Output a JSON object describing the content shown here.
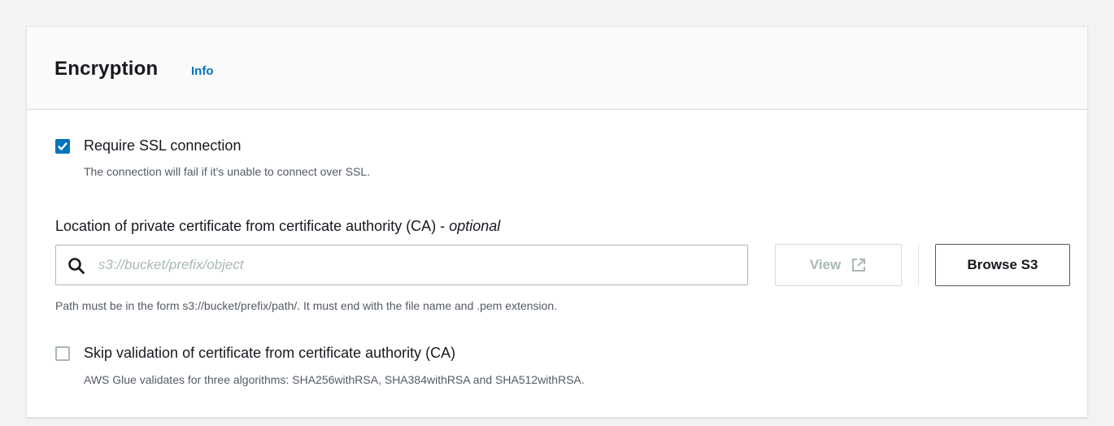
{
  "section": {
    "title": "Encryption",
    "info_link": "Info"
  },
  "require_ssl": {
    "checked": true,
    "label": "Require SSL connection",
    "description": "The connection will fail if it's unable to connect over SSL."
  },
  "ca_location": {
    "label": "Location of private certificate from certificate authority (CA) - ",
    "label_optional": "optional",
    "input_value": "",
    "placeholder": "s3://bucket/prefix/object",
    "view_button": "View",
    "browse_button": "Browse S3",
    "hint": "Path must be in the form s3://bucket/prefix/path/. It must end with the file name and .pem extension."
  },
  "skip_validation": {
    "checked": false,
    "label": "Skip validation of certificate from certificate authority (CA)",
    "description": "AWS Glue validates for three algorithms: SHA256withRSA, SHA384withRSA and SHA512withRSA."
  },
  "icons": {
    "search": "search-icon",
    "external_link": "external-link-icon",
    "check": "check-icon"
  },
  "colors": {
    "accent": "#0073bb",
    "text": "#16191f",
    "muted": "#545b64",
    "disabled": "#aab7b8"
  }
}
